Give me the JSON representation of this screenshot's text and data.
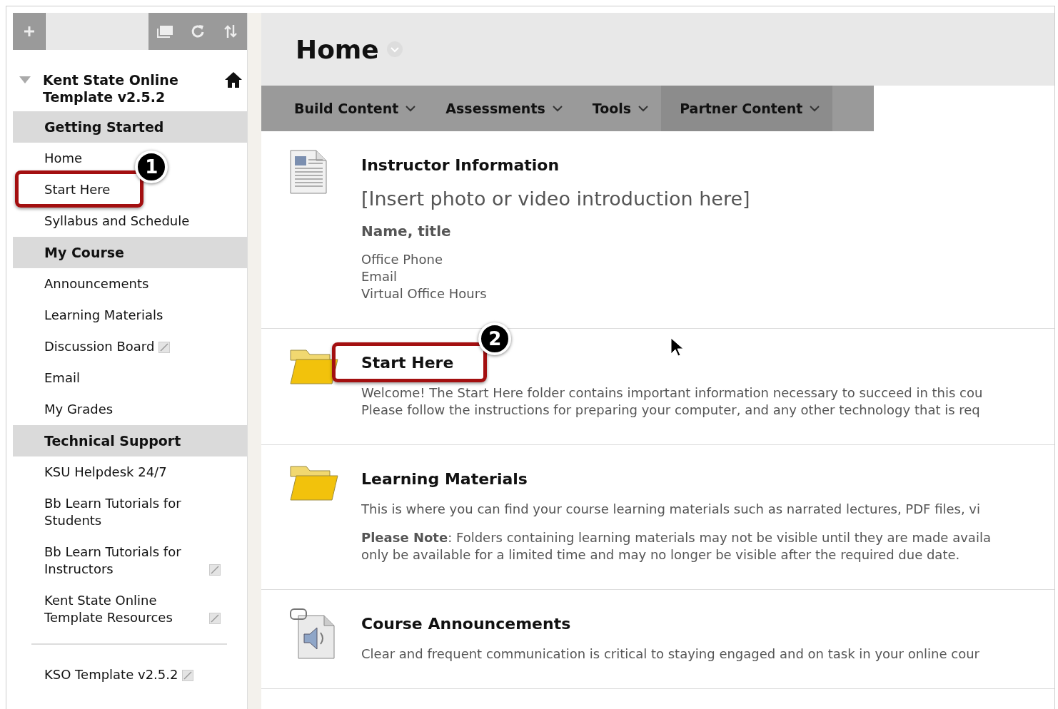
{
  "sidebar": {
    "toolbar": {
      "buttons": [
        {
          "kind": "add"
        },
        {
          "kind": "window"
        },
        {
          "kind": "refresh"
        },
        {
          "kind": "sort"
        }
      ]
    },
    "course_title": "Kent State Online Template v2.5.2",
    "expanded": true,
    "items": [
      {
        "kind": "header",
        "label": "Getting Started"
      },
      {
        "kind": "link",
        "label": "Home",
        "external": false
      },
      {
        "kind": "link",
        "label": "Start Here",
        "external": false,
        "callout": "1"
      },
      {
        "kind": "link",
        "label": "Syllabus and Schedule",
        "external": false
      },
      {
        "kind": "header",
        "label": "My Course"
      },
      {
        "kind": "link",
        "label": "Announcements",
        "external": false
      },
      {
        "kind": "link",
        "label": "Learning Materials",
        "external": false
      },
      {
        "kind": "link",
        "label": "Discussion Board",
        "external": true
      },
      {
        "kind": "link",
        "label": "Email",
        "external": false
      },
      {
        "kind": "link",
        "label": "My Grades",
        "external": false
      },
      {
        "kind": "header",
        "label": "Technical Support"
      },
      {
        "kind": "link",
        "label": "KSU Helpdesk 24/7",
        "external": false
      },
      {
        "kind": "link",
        "label": "Bb Learn Tutorials for Students",
        "external": false
      },
      {
        "kind": "link",
        "label": "Bb Learn Tutorials for Instructors",
        "external": true
      },
      {
        "kind": "link",
        "label": "Kent State Online Template Resources",
        "external": true
      },
      {
        "kind": "divider"
      },
      {
        "kind": "link",
        "label": "KSO Template v2.5.2",
        "external": true
      }
    ]
  },
  "page": {
    "title": "Home",
    "menu": [
      "Build Content",
      "Assessments",
      "Tools",
      "Partner Content"
    ],
    "items": [
      {
        "kind": "document",
        "title": "Instructor Information",
        "blocks": [
          {
            "kind": "large",
            "text": "[Insert photo or video introduction here]"
          },
          {
            "kind": "bold",
            "text": "Name, title"
          },
          {
            "kind": "lines",
            "lines": [
              "Office Phone",
              "Email",
              "Virtual Office Hours"
            ]
          }
        ]
      },
      {
        "kind": "folder",
        "title": "Start Here",
        "callout": "2",
        "blocks": [
          {
            "kind": "lines",
            "lines": [
              "Welcome! The Start Here folder contains important information necessary to succeed in this cou",
              "Please follow the instructions for preparing your computer, and any other technology that is req"
            ]
          }
        ]
      },
      {
        "kind": "folder",
        "title": "Learning Materials",
        "blocks": [
          {
            "kind": "lines",
            "lines": [
              "This is where you can find your course learning materials such as narrated lectures, PDF files, vi"
            ]
          },
          {
            "kind": "lines",
            "lines": [
              "**Please Note**: Folders containing learning materials may not be visible until they are made availa",
              "only be available for a limited time and may no longer be visible after the required due date."
            ]
          }
        ]
      },
      {
        "kind": "audio",
        "title": "Course Announcements",
        "blocks": [
          {
            "kind": "lines",
            "lines": [
              "Clear and frequent communication is critical to staying engaged and on task in your online cour"
            ]
          }
        ]
      }
    ]
  }
}
